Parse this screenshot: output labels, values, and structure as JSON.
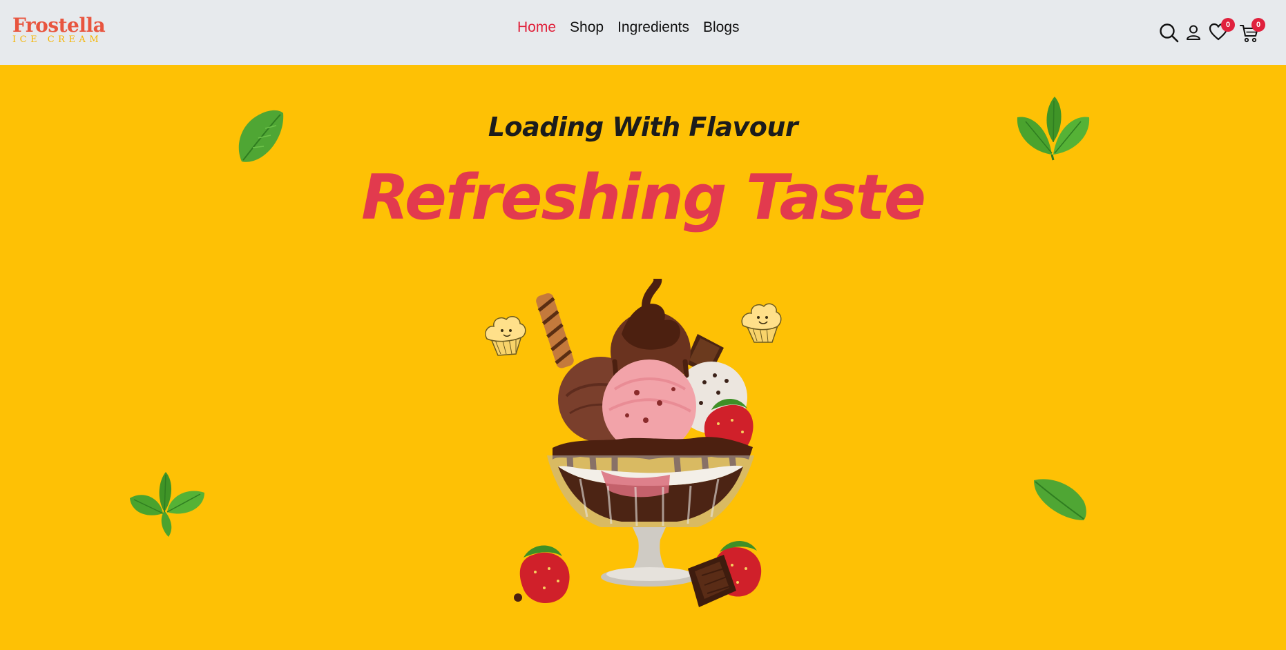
{
  "brand": {
    "name": "Frostella",
    "subtitle": "ICE CREAM"
  },
  "nav": {
    "items": [
      {
        "label": "Home",
        "active": true
      },
      {
        "label": "Shop",
        "active": false
      },
      {
        "label": "Ingredients",
        "active": false
      },
      {
        "label": "Blogs",
        "active": false
      }
    ]
  },
  "header_icons": {
    "search": "search-icon",
    "account": "user-icon",
    "wishlist": {
      "icon": "heart-icon",
      "count": "0"
    },
    "cart": {
      "icon": "cart-icon",
      "count": "0"
    }
  },
  "hero": {
    "tagline": "Loading With Flavour",
    "headline": "Refreshing Taste",
    "image": "ice-cream-sundae",
    "decorations": [
      "mint-leaf",
      "mint-leaf",
      "mint-leaf",
      "mint-leaf",
      "cupcake-doodle",
      "cupcake-doodle"
    ]
  },
  "colors": {
    "header_bg": "#e7eaed",
    "hero_bg": "#fec105",
    "accent": "#e23a4e",
    "nav_active": "#e0203a",
    "badge": "#e0213d"
  }
}
